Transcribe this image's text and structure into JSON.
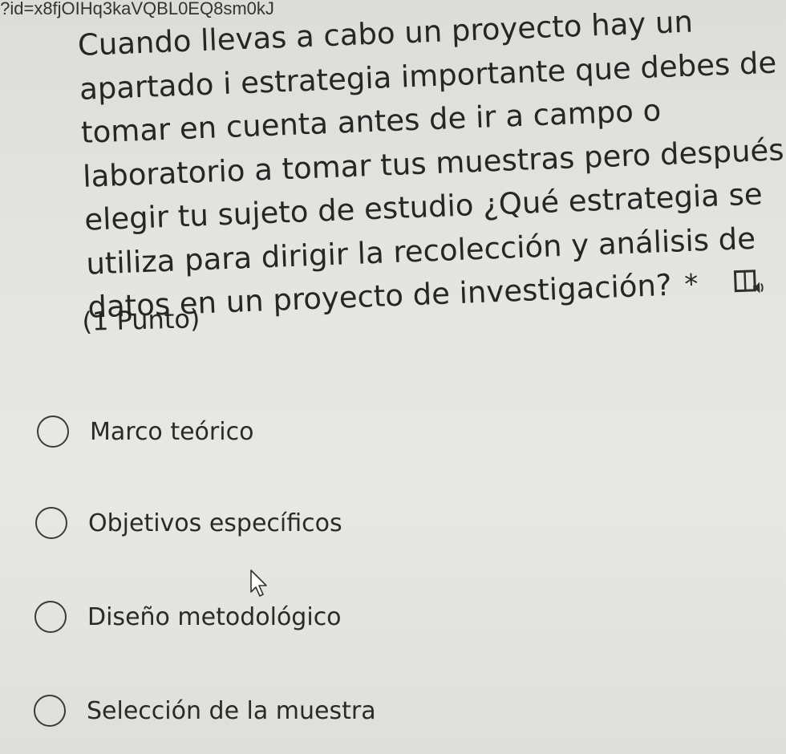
{
  "browser": {
    "url_fragment": ":?id=x8fjOIHq3kaVQBL0EQ8sm0kJ"
  },
  "question": {
    "lines": [
      "Cuando llevas a cabo un proyecto hay un",
      "apartado i estrategia importante que debes de",
      "tomar en cuenta antes de ir a campo o",
      "laboratorio a tomar tus muestras pero después de",
      "elegir tu sujeto de estudio ¿Qué estrategia se",
      "utiliza para dirigir la recolección y análisis de",
      "datos en un proyecto de investigación?"
    ],
    "required_mark": "*",
    "immersive_reader_icon": "immersive-reader-icon",
    "points": "(1 Punto)"
  },
  "options": [
    {
      "label": "Marco teórico",
      "selected": false
    },
    {
      "label": "Objetivos específicos",
      "selected": false
    },
    {
      "label": "Diseño metodológico",
      "selected": false
    },
    {
      "label": "Selección de la muestra",
      "selected": false
    }
  ]
}
